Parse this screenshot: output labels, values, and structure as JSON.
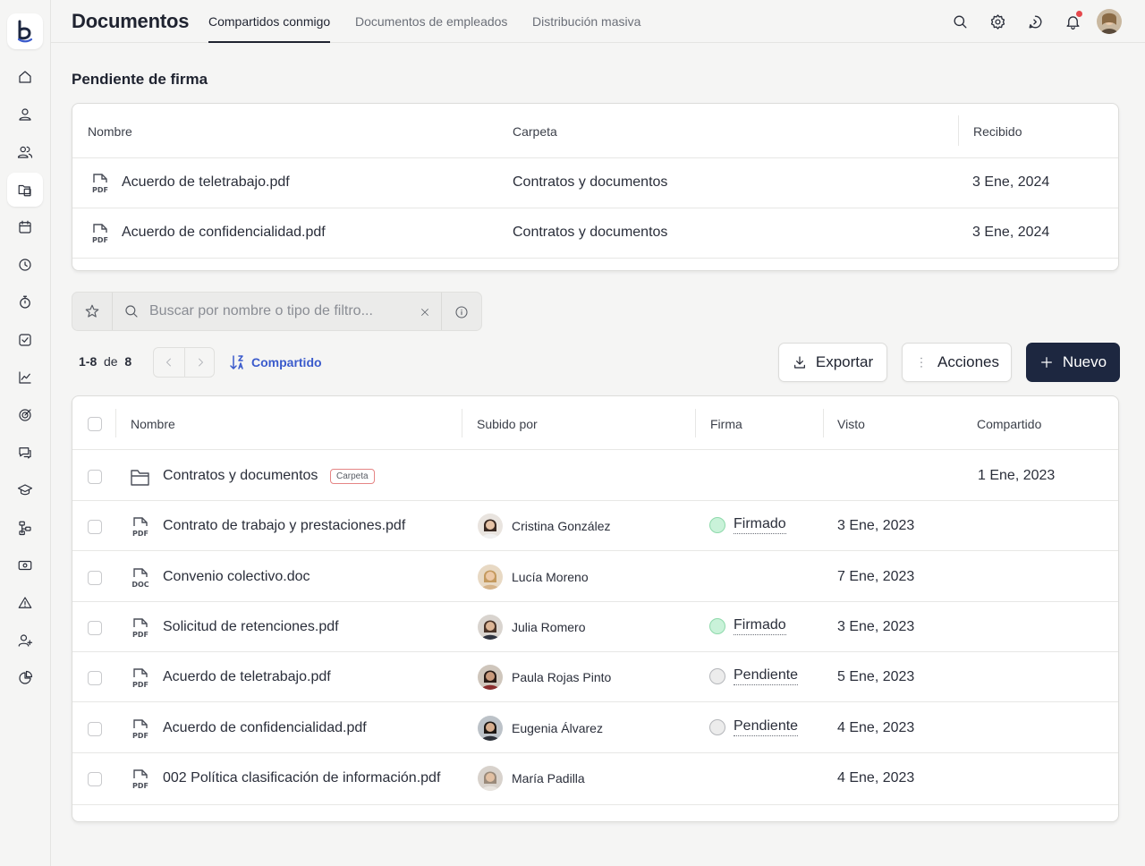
{
  "header": {
    "title": "Documentos",
    "tabs": [
      {
        "label": "Compartidos conmigo",
        "active": true
      },
      {
        "label": "Documentos de empleados",
        "active": false
      },
      {
        "label": "Distribución masiva",
        "active": false
      }
    ],
    "icons": [
      "search-icon",
      "settings-icon",
      "chat-refresh-icon",
      "bell-icon",
      "user-avatar"
    ]
  },
  "sidebar": {
    "logo": "b",
    "items": [
      "home",
      "user",
      "users",
      "folder-documents",
      "calendar",
      "clock",
      "stopwatch",
      "checkbox",
      "chart",
      "target",
      "chat",
      "graduation-cap",
      "org-chart",
      "payroll",
      "alert",
      "add-user",
      "pie-chart"
    ],
    "active_index": 3
  },
  "pending": {
    "title": "Pendiente de firma",
    "columns": [
      "Nombre",
      "Carpeta",
      "Recibido"
    ],
    "rows": [
      {
        "icon": "PDF",
        "name": "Acuerdo de teletrabajo.pdf",
        "folder": "Contratos y documentos",
        "received": "3 Ene, 2024"
      },
      {
        "icon": "PDF",
        "name": "Acuerdo de confidencialidad.pdf",
        "folder": "Contratos y documentos",
        "received": "3 Ene, 2024"
      }
    ]
  },
  "search": {
    "placeholder": "Buscar por nombre o tipo de filtro..."
  },
  "pagination": {
    "range": "1-8",
    "of_label": "de",
    "total": "8",
    "sort_label": "Compartido"
  },
  "actions": {
    "export_label": "Exportar",
    "actions_label": "Acciones",
    "new_label": "Nuevo"
  },
  "documents": {
    "columns": [
      "Nombre",
      "Subido por",
      "Firma",
      "Visto",
      "Compartido"
    ],
    "folder_row": {
      "name": "Contratos y documentos",
      "badge": "Carpeta",
      "shared": "1 Ene, 2023"
    },
    "rows": [
      {
        "icon": "PDF",
        "name": "Contrato de trabajo y prestaciones.pdf",
        "uploader": "Cristina González",
        "signature": "Firmado",
        "sig_state": "signed",
        "seen": "3 Ene, 2023"
      },
      {
        "icon": "DOC",
        "name": "Convenio colectivo.doc",
        "uploader": "Lucía Moreno",
        "signature": "",
        "sig_state": "none",
        "seen": "7 Ene, 2023"
      },
      {
        "icon": "PDF",
        "name": "Solicitud de retenciones.pdf",
        "uploader": "Julia Romero",
        "signature": "Firmado",
        "sig_state": "signed",
        "seen": "3 Ene, 2023"
      },
      {
        "icon": "PDF",
        "name": "Acuerdo de teletrabajo.pdf",
        "uploader": "Paula Rojas Pinto",
        "signature": "Pendiente",
        "sig_state": "pending",
        "seen": "5 Ene, 2023"
      },
      {
        "icon": "PDF",
        "name": "Acuerdo de confidencialidad.pdf",
        "uploader": "Eugenia Álvarez",
        "signature": "Pendiente",
        "sig_state": "pending",
        "seen": "4 Ene, 2023"
      },
      {
        "icon": "PDF",
        "name": "002 Política clasificación de información.pdf",
        "uploader": "María Padilla",
        "signature": "",
        "sig_state": "none",
        "seen": "4 Ene, 2023"
      }
    ]
  }
}
